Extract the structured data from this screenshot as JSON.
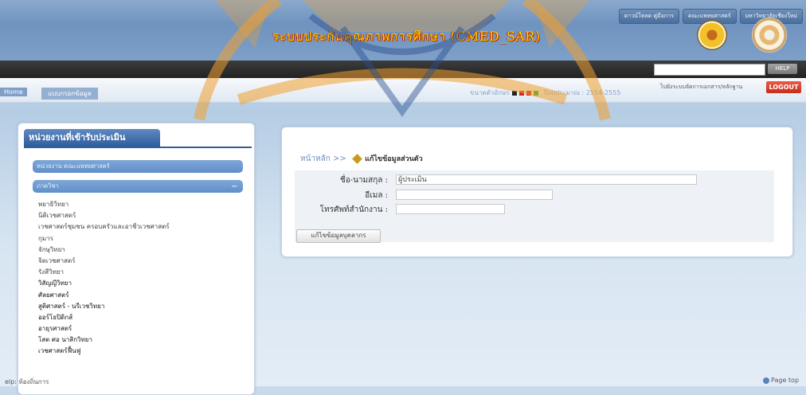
{
  "header": {
    "title": "ระบบประกันคุณภาพการศึกษา (CMED_SAR)",
    "links": [
      "ดาวน์โหลด คู่มือการ",
      "คณะแพทยศาสตร์",
      "มหาวิทยาลัยเชียงใหม่"
    ],
    "help_label": "HELP"
  },
  "breadcrumb": {
    "home": "Home",
    "current": "แบบกรอกข้อมูล"
  },
  "font_size_label": "ขนาดตัวอักษร",
  "year_label": "ปีงบประมาณ : 2554-2555",
  "quality_link": "ไปยังระบบจัดการเอกสาร/หลักฐาน",
  "logout_label": "LOGOUT",
  "sidebar": {
    "title": "หน่วยงานที่เข้ารับประเมิน",
    "groups": [
      "หน่วยงาน คณะแพทยศาสตร์",
      "ภาควิชา"
    ],
    "items": [
      "พยาธิวิทยา",
      "นิติเวชศาสตร์",
      "เวชศาสตร์ชุมชน ครอบครัวและอาชีวเวชศาสตร์",
      "กุมาร",
      "จักษุวิทยา",
      "จิตเวชศาสตร์",
      "รังสีวิทยา",
      "วิสัญญีวิทยา",
      "ศัลยศาสตร์",
      "สูติศาสตร์ - นรีเวชวิทยา",
      "ออร์โธปิดิกส์",
      "อายุรศาสตร์",
      "โสต ศอ นาสิกวิทยา",
      "เวชศาสตร์ฟื้นฟู"
    ]
  },
  "content": {
    "crumb_home": "หน้าหลัก",
    "crumb_sep": ">>",
    "crumb_title": "แก้ไขข้อมูลส่วนตัว",
    "name_label": "ชื่อ-นามสกุล :",
    "name_value": "ผู้ประเมิน",
    "email_label": "อีเมล :",
    "phone_label": "โทรศัพท์สำนักงาน :",
    "edit_button": "แก้ไขข้อมูลบุคลากร"
  },
  "status": {
    "left": "elp: ท้องถิ่นการ",
    "page_top": "Page top"
  },
  "colors": {
    "watermark": "#f0a030",
    "logout": "#d43a24",
    "title": "#ffd200"
  }
}
